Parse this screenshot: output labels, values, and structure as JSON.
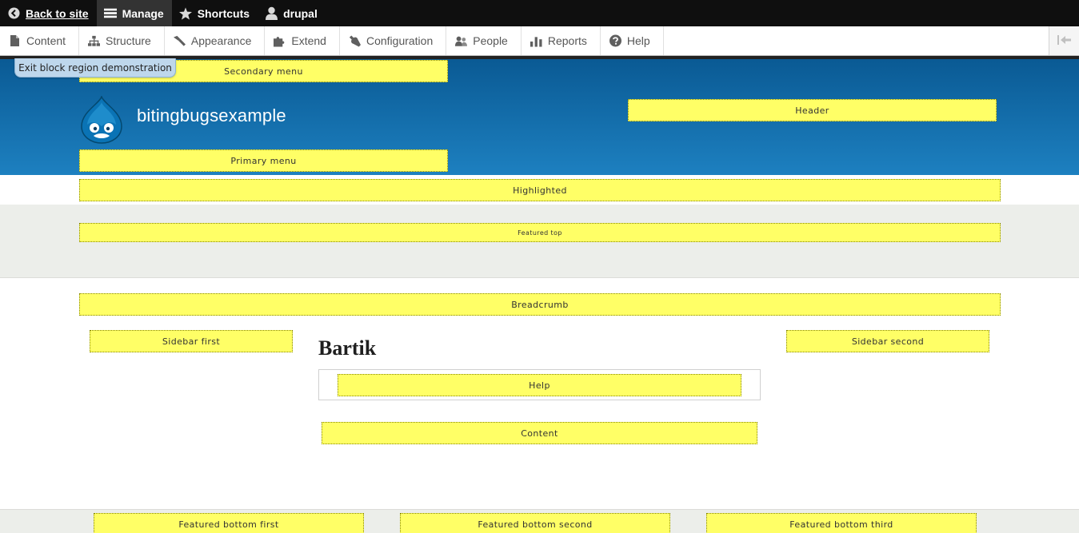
{
  "toolbar": {
    "back_label": "Back to site",
    "manage_label": "Manage",
    "shortcuts_label": "Shortcuts",
    "user_label": "drupal"
  },
  "tray": {
    "items": [
      {
        "label": "Content",
        "icon": "file-icon"
      },
      {
        "label": "Structure",
        "icon": "sitemap-icon"
      },
      {
        "label": "Appearance",
        "icon": "paintbrush-icon"
      },
      {
        "label": "Extend",
        "icon": "puzzle-icon"
      },
      {
        "label": "Configuration",
        "icon": "wrench-icon"
      },
      {
        "label": "People",
        "icon": "people-icon"
      },
      {
        "label": "Reports",
        "icon": "bar-chart-icon"
      },
      {
        "label": "Help",
        "icon": "question-icon"
      }
    ]
  },
  "exit_demo_label": "Exit block region demonstration",
  "site": {
    "name": "bitingbugsexample"
  },
  "regions": {
    "secondary_menu": "Secondary menu",
    "header": "Header",
    "primary_menu": "Primary menu",
    "highlighted": "Highlighted",
    "featured_top": "Featured top",
    "breadcrumb": "Breadcrumb",
    "sidebar_first": "Sidebar first",
    "sidebar_second": "Sidebar second",
    "help": "Help",
    "content": "Content",
    "featured_bottom_first": "Featured bottom first",
    "featured_bottom_second": "Featured bottom second",
    "featured_bottom_third": "Featured bottom third"
  },
  "page_title": "Bartik",
  "colors": {
    "header_top": "#0a5a94",
    "header_bottom": "#1d80c0",
    "region_fill": "#ffff66",
    "toolbar_bg": "#0f0f0f"
  }
}
